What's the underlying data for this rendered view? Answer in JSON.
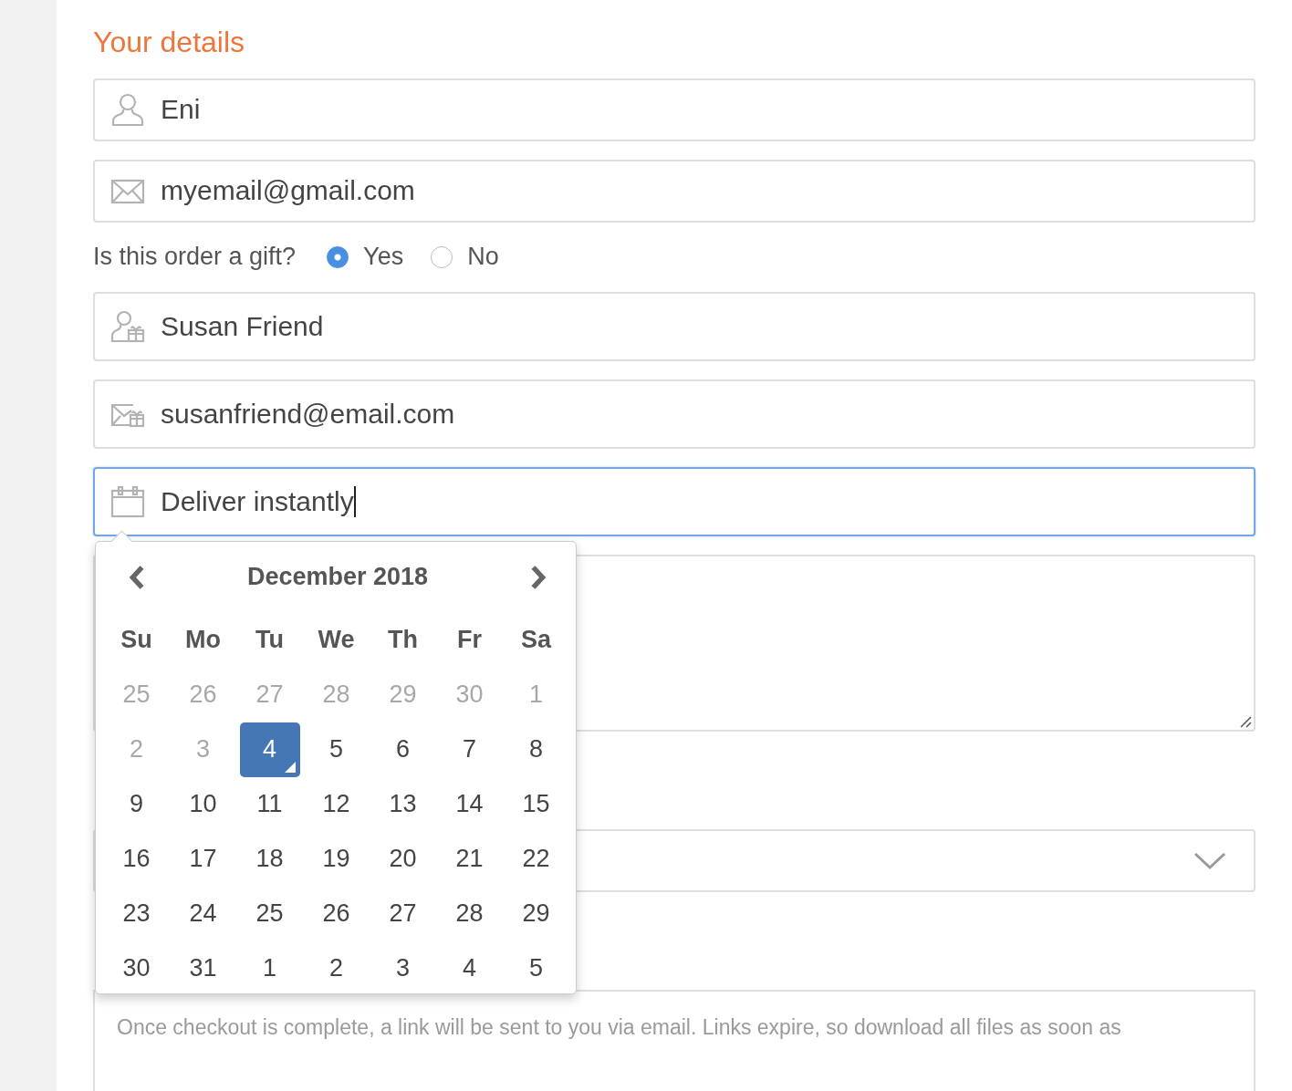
{
  "heading": "Your details",
  "fields": [
    {
      "kind": "person",
      "value": "Eni",
      "focused": false
    },
    {
      "kind": "mail",
      "value": "myemail@gmail.com",
      "focused": false
    }
  ],
  "gift": {
    "question": "Is this order a gift?",
    "options": [
      {
        "label": "Yes",
        "selected": true
      },
      {
        "label": "No",
        "selected": false
      }
    ]
  },
  "recipient_fields": [
    {
      "kind": "person-gift",
      "value": "Susan Friend",
      "focused": false
    },
    {
      "kind": "mail-gift",
      "value": "susanfriend@email.com",
      "focused": false
    },
    {
      "kind": "calendar",
      "value": "Deliver instantly",
      "focused": true
    }
  ],
  "calendar": {
    "title": "December 2018",
    "weekdays": [
      "Su",
      "Mo",
      "Tu",
      "We",
      "Th",
      "Fr",
      "Sa"
    ],
    "weeks": [
      [
        {
          "day": "25",
          "muted": true,
          "selected": false
        },
        {
          "day": "26",
          "muted": true,
          "selected": false
        },
        {
          "day": "27",
          "muted": true,
          "selected": false
        },
        {
          "day": "28",
          "muted": true,
          "selected": false
        },
        {
          "day": "29",
          "muted": true,
          "selected": false
        },
        {
          "day": "30",
          "muted": true,
          "selected": false
        },
        {
          "day": "1",
          "muted": true,
          "selected": false
        }
      ],
      [
        {
          "day": "2",
          "muted": true,
          "selected": false
        },
        {
          "day": "3",
          "muted": true,
          "selected": false
        },
        {
          "day": "4",
          "muted": false,
          "selected": true
        },
        {
          "day": "5",
          "muted": false,
          "selected": false
        },
        {
          "day": "6",
          "muted": false,
          "selected": false
        },
        {
          "day": "7",
          "muted": false,
          "selected": false
        },
        {
          "day": "8",
          "muted": false,
          "selected": false
        }
      ],
      [
        {
          "day": "9",
          "muted": false,
          "selected": false
        },
        {
          "day": "10",
          "muted": false,
          "selected": false
        },
        {
          "day": "11",
          "muted": false,
          "selected": false
        },
        {
          "day": "12",
          "muted": false,
          "selected": false
        },
        {
          "day": "13",
          "muted": false,
          "selected": false
        },
        {
          "day": "14",
          "muted": false,
          "selected": false
        },
        {
          "day": "15",
          "muted": false,
          "selected": false
        }
      ],
      [
        {
          "day": "16",
          "muted": false,
          "selected": false
        },
        {
          "day": "17",
          "muted": false,
          "selected": false
        },
        {
          "day": "18",
          "muted": false,
          "selected": false
        },
        {
          "day": "19",
          "muted": false,
          "selected": false
        },
        {
          "day": "20",
          "muted": false,
          "selected": false
        },
        {
          "day": "21",
          "muted": false,
          "selected": false
        },
        {
          "day": "22",
          "muted": false,
          "selected": false
        }
      ],
      [
        {
          "day": "23",
          "muted": false,
          "selected": false
        },
        {
          "day": "24",
          "muted": false,
          "selected": false
        },
        {
          "day": "25",
          "muted": false,
          "selected": false
        },
        {
          "day": "26",
          "muted": false,
          "selected": false
        },
        {
          "day": "27",
          "muted": false,
          "selected": false
        },
        {
          "day": "28",
          "muted": false,
          "selected": false
        },
        {
          "day": "29",
          "muted": false,
          "selected": false
        }
      ],
      [
        {
          "day": "30",
          "muted": false,
          "selected": false
        },
        {
          "day": "31",
          "muted": false,
          "selected": false
        },
        {
          "day": "1",
          "muted": false,
          "selected": false
        },
        {
          "day": "2",
          "muted": false,
          "selected": false
        },
        {
          "day": "3",
          "muted": false,
          "selected": false
        },
        {
          "day": "4",
          "muted": false,
          "selected": false
        },
        {
          "day": "5",
          "muted": false,
          "selected": false
        }
      ]
    ]
  },
  "notice": "Once checkout is complete, a link will be sent to you via email. Links expire, so download all files as soon as"
}
